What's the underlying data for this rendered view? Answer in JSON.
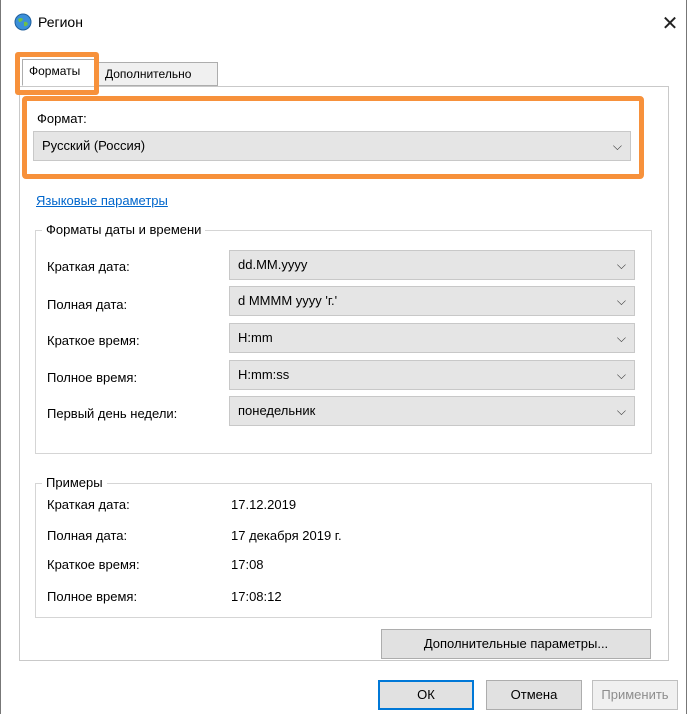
{
  "window": {
    "title": "Регион",
    "close_glyph": "✕",
    "icon": "globe-icon"
  },
  "tabs": [
    {
      "label": "Форматы",
      "active": true
    },
    {
      "label": "Дополнительно",
      "active": false
    }
  ],
  "format": {
    "label": "Формат:",
    "value": "Русский (Россия)"
  },
  "language_link": "Языковые параметры",
  "datetime_group": {
    "title": "Форматы даты и времени",
    "rows": [
      {
        "label": "Краткая дата:",
        "value": "dd.MM.yyyy"
      },
      {
        "label": "Полная дата:",
        "value": "d MMMM yyyy 'г.'"
      },
      {
        "label": "Краткое время:",
        "value": "H:mm"
      },
      {
        "label": "Полное время:",
        "value": "H:mm:ss"
      },
      {
        "label": "Первый день недели:",
        "value": "понедельник"
      }
    ]
  },
  "examples": {
    "title": "Примеры",
    "rows": [
      {
        "label": "Краткая дата:",
        "value": "17.12.2019"
      },
      {
        "label": "Полная дата:",
        "value": "17 декабря 2019 г."
      },
      {
        "label": "Краткое время:",
        "value": "17:08"
      },
      {
        "label": "Полное время:",
        "value": "17:08:12"
      }
    ]
  },
  "buttons": {
    "additional": "Дополнительные параметры...",
    "ok": "ОК",
    "cancel": "Отмена",
    "apply": "Применить"
  },
  "colors": {
    "highlight": "#f7913b",
    "link": "#0066cc",
    "ok_border": "#0078d7"
  }
}
